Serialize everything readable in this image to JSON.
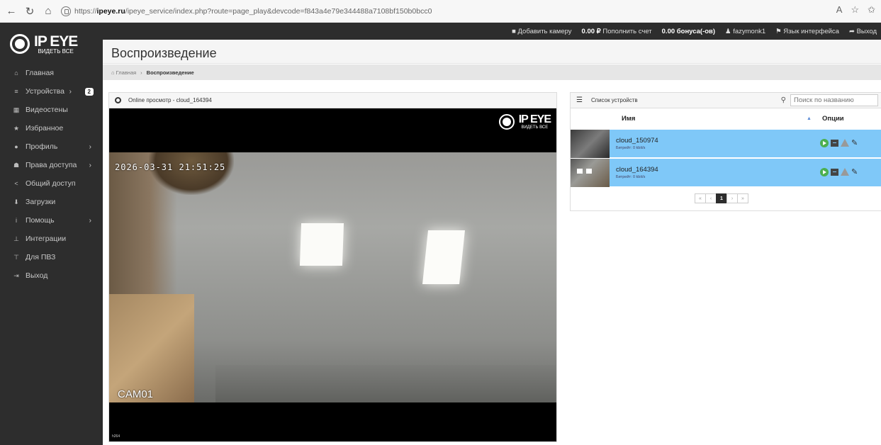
{
  "browser": {
    "url_host": "ipeye.ru",
    "url_prefix": "https://",
    "url_rest": "/ipeye_service/index.php?route=page_play&devcode=f843a4e79e344488a7108bf150b0bcc0",
    "back_icon": "arrow-left-icon",
    "reload_icon": "reload-icon",
    "home_icon": "home-icon"
  },
  "logo": {
    "big": "IP EYE",
    "small": "ВИДЕТЬ ВСЕ"
  },
  "sidebar": {
    "items": [
      {
        "label": "Главная",
        "icon": "home-icon",
        "glyph": "⌂"
      },
      {
        "label": "Устройства",
        "icon": "list-icon",
        "glyph": "≡",
        "badge": "2"
      },
      {
        "label": "Видеостены",
        "icon": "grid-icon",
        "glyph": "▦"
      },
      {
        "label": "Избранное",
        "icon": "star-icon",
        "glyph": "★"
      },
      {
        "label": "Профиль",
        "icon": "user-icon",
        "glyph": "●"
      },
      {
        "label": "Права доступа",
        "icon": "users-icon",
        "glyph": "☗"
      },
      {
        "label": "Общий доступ",
        "icon": "share-icon",
        "glyph": "<"
      },
      {
        "label": "Загрузки",
        "icon": "download-icon",
        "glyph": "⬇"
      },
      {
        "label": "Помощь",
        "icon": "info-icon",
        "glyph": "i"
      },
      {
        "label": "Интеграции",
        "icon": "sitemap-icon",
        "glyph": "⊥"
      },
      {
        "label": "Для ПВЗ",
        "icon": "cart-icon",
        "glyph": "⊤"
      },
      {
        "label": "Выход",
        "icon": "logout-icon",
        "glyph": "⇥"
      }
    ]
  },
  "topbar": {
    "add_camera": "Добавить камеру",
    "balance_amount": "0.00 ₽",
    "top_up": "Пополнить счет",
    "bonus": "0.00 бонуса(-ов)",
    "username": "fazymonk1",
    "language": "Язык интерфейса",
    "logout": "Выход"
  },
  "page": {
    "title": "Воспроизведение",
    "breadcrumb_home": "Главная",
    "breadcrumb_sep": "›",
    "breadcrumb_current": "Воспроизведение"
  },
  "video_panel": {
    "title": "Online просмотр - cloud_164394",
    "osd_time": "2026-03-31 21:51:25",
    "osd_cam": "CAM01",
    "codec": "h264"
  },
  "device_panel": {
    "title": "Список устройств",
    "search_placeholder": "Поиск по названию",
    "col_name": "Имя",
    "col_options": "Опции",
    "sort_icon": "sort-asc-icon",
    "rows": [
      {
        "name": "cloud_150974",
        "bitrate": "Битрейт: 0 kbit/s"
      },
      {
        "name": "cloud_164394",
        "bitrate": "Битрейт: 0 kbit/s"
      }
    ],
    "pager": [
      "«",
      "‹",
      "1",
      "›",
      "»"
    ],
    "colors": {
      "row_bg": "#7fc8f8",
      "play": "#4caf50"
    }
  }
}
